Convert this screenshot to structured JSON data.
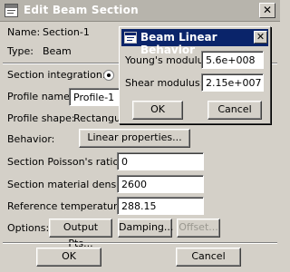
{
  "window": {
    "title": "Edit Beam Section",
    "close_glyph": "✕"
  },
  "info": {
    "name_label": "Name:",
    "name_value": "Section-1",
    "type_label": "Type:",
    "type_value": "Beam"
  },
  "section_integration": {
    "label": "Section integration:"
  },
  "profile_name": {
    "label": "Profile name:",
    "value": "Profile-1"
  },
  "profile_shape": {
    "label": "Profile shape:",
    "value": "Rectangul"
  },
  "behavior": {
    "label": "Behavior:",
    "button_label": "Linear properties..."
  },
  "poisson": {
    "label": "Section Poisson's ratio:",
    "value": "0"
  },
  "density": {
    "label": "Section material density:",
    "value": "2600"
  },
  "reference_temperature": {
    "label": "Reference temperature:",
    "value": "288.15"
  },
  "options": {
    "label": "Options:",
    "output_pts_label": "Output Pts...",
    "damping_label": "Damping...",
    "offset_label": "Offset..."
  },
  "footer": {
    "ok_label": "OK",
    "cancel_label": "Cancel"
  },
  "popup": {
    "title": "Beam Linear Behavior",
    "close_glyph": "✕",
    "youngs_label": "Young's modulus:",
    "youngs_value": "5.6e+008",
    "shear_label": "Shear modulus:",
    "shear_value": "2.15e+007",
    "ok_label": "OK",
    "cancel_label": "Cancel"
  },
  "colors": {
    "active_title": "#0a246a",
    "inactive_title": "#b7b4ac",
    "face": "#d4d0c8"
  }
}
